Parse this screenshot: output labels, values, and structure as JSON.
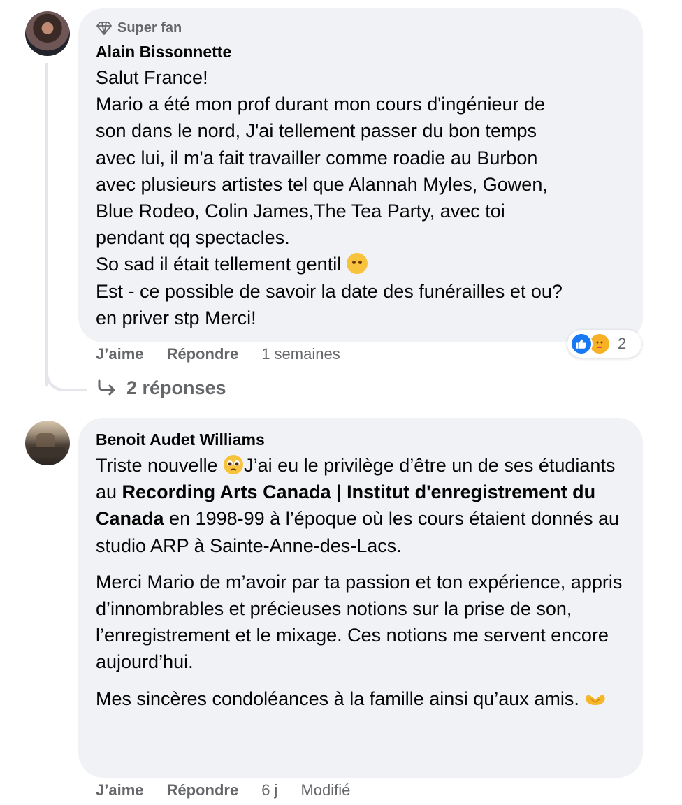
{
  "comments": [
    {
      "badge": "Super fan",
      "author": "Alain Bissonnette",
      "lines": [
        "Salut France!",
        "Mario a été mon prof durant mon cours d'ingénieur de",
        "son dans le nord, J'ai tellement passer du bon temps",
        "avec lui, il m'a fait travailler comme roadie au Burbon",
        "avec plusieurs artistes tel que Alannah Myles, Gowen,",
        "Blue Rodeo, Colin James,The Tea Party, avec toi",
        "pendant qq spectacles.",
        "So sad il était tellement gentil",
        "Est - ce possible de savoir la date des funérailles et ou?",
        "en priver stp Merci!"
      ],
      "like_label": "J’aime",
      "reply_label": "Répondre",
      "time": "1 semaines",
      "reaction_count": "2",
      "reactions": [
        "like-icon",
        "care-icon"
      ],
      "replies_label": "2 réponses"
    },
    {
      "author": "Benoit Audet Williams",
      "p1_a": "Triste nouvelle ",
      "p1_b": "J’ai eu le privilège d’être un de ses étudiants au ",
      "p1_strong": "Recording Arts Canada | Institut d'enregistrement du Canada",
      "p1_c": " en 1998-99 à l’époque où les cours étaient donnés au studio ARP à Sainte-Anne-des-Lacs.",
      "p2": "Merci Mario de m’avoir par ta passion et ton expérience, appris d’innombrables et précieuses notions sur la prise de son, l’enregistrement et le mixage. Ces notions me servent encore aujourd’hui.",
      "p3": "Mes sincères condoléances à la famille ainsi qu’aux amis. ",
      "like_label": "J’aime",
      "reply_label": "Répondre",
      "time": "6 j",
      "edited": "Modifié"
    }
  ],
  "colors": {
    "bubble": "#f0f2f5",
    "meta": "#65676b",
    "like": "#1877f2"
  }
}
